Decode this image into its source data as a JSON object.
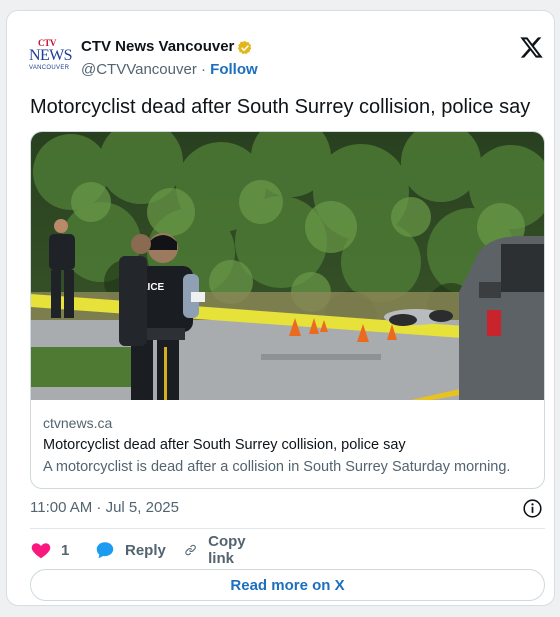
{
  "author": {
    "name": "CTV News Vancouver",
    "handle": "@CTVVancouver",
    "separator": "·",
    "follow_label": "Follow",
    "avatar_ctv": "CTV",
    "avatar_news": "NEWS",
    "avatar_city": "VANCOUVER",
    "verified_icon": "verified-gold-badge-icon"
  },
  "tweet": {
    "text": "Motorcyclist dead after South Surrey collision, police say"
  },
  "link_card": {
    "image": {
      "description_icon": "news-photo",
      "police_vest_text": "POLICE"
    },
    "domain": "ctvnews.ca",
    "title": "Motorcyclist dead after South Surrey collision, police say",
    "description": "A motorcyclist is dead after a collision in South Surrey Saturday morning."
  },
  "meta": {
    "timestamp": "11:00 AM · Jul 5, 2025"
  },
  "actions": {
    "like_count": "1",
    "reply_label": "Reply",
    "copy_label": "Copy link"
  },
  "footer": {
    "read_more_label": "Read more on X"
  },
  "colors": {
    "accent": "#1d6fbf",
    "heart": "#f91880",
    "reply_bubble": "#1d9bf0",
    "verified": "#e2b719",
    "muted": "#536471"
  }
}
